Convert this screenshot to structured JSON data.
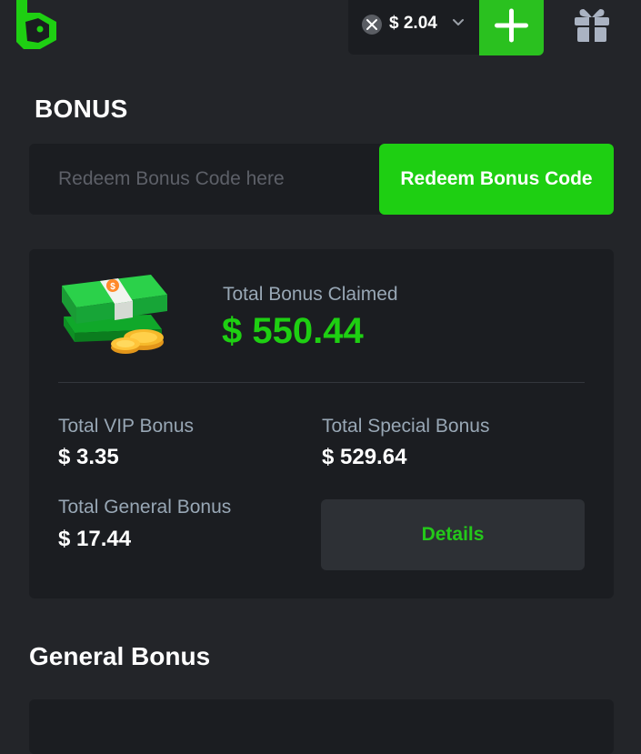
{
  "header": {
    "balance": "$ 2.04",
    "add_funds_label": "+"
  },
  "bonus": {
    "title": "BONUS",
    "redeem": {
      "placeholder": "Redeem Bonus Code here",
      "value": "",
      "button_label": "Redeem Bonus Code"
    },
    "summary": {
      "claimed_label": "Total Bonus Claimed",
      "claimed_value": "$ 550.44",
      "vip_label": "Total VIP Bonus",
      "vip_value": "$ 3.35",
      "special_label": "Total Special Bonus",
      "special_value": "$ 529.64",
      "general_label": "Total General Bonus",
      "general_value": "$ 17.44",
      "details_label": "Details"
    }
  },
  "general_bonus": {
    "title": "General Bonus"
  },
  "colors": {
    "accent": "#1ecf12",
    "background": "#232529",
    "card": "#1b1d21",
    "muted_text": "#98a7b5"
  },
  "icons": {
    "logo": "bc-logo-icon",
    "coin": "currency-coin-icon",
    "chevron": "chevron-down-icon",
    "gift": "gift-icon",
    "money": "money-stack-icon"
  }
}
